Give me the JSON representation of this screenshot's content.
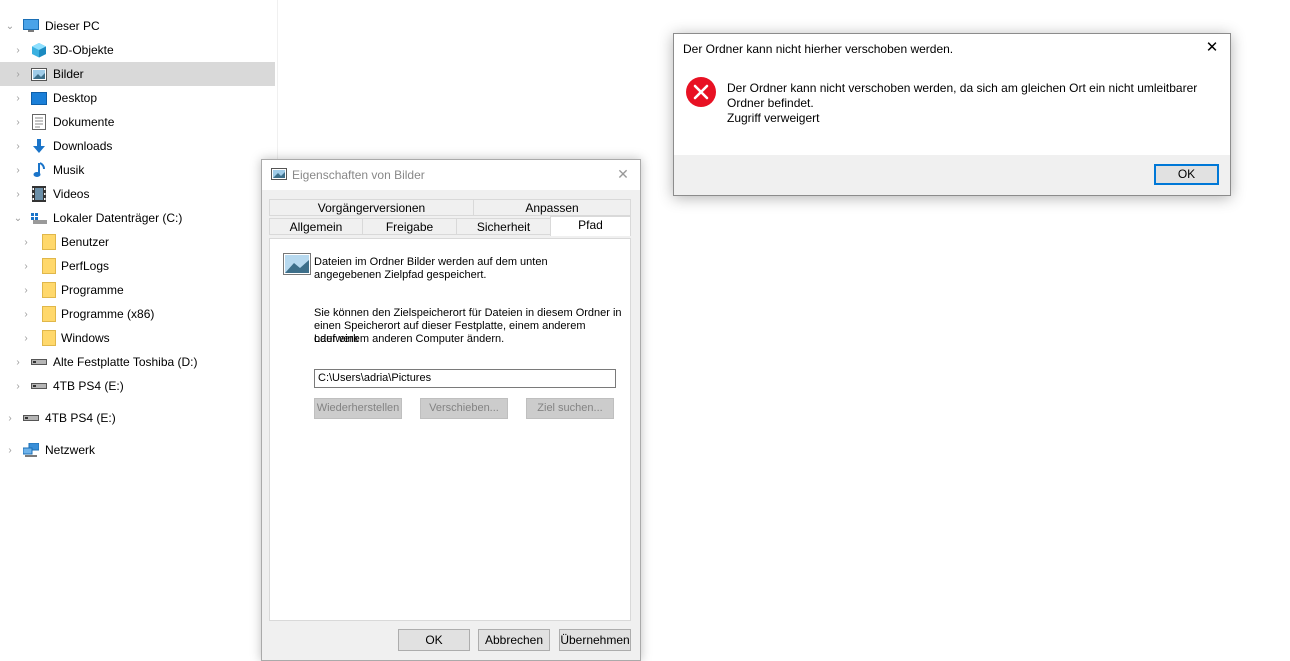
{
  "tree": {
    "items": [
      {
        "label": "Dieser PC",
        "icon": "computer-icon",
        "expanded": true
      },
      {
        "label": "3D-Objekte",
        "icon": "cube-icon"
      },
      {
        "label": "Bilder",
        "icon": "pictures-icon",
        "selected": true
      },
      {
        "label": "Desktop",
        "icon": "desktop-icon"
      },
      {
        "label": "Dokumente",
        "icon": "document-icon"
      },
      {
        "label": "Downloads",
        "icon": "download-icon"
      },
      {
        "label": "Musik",
        "icon": "music-icon"
      },
      {
        "label": "Videos",
        "icon": "video-icon"
      },
      {
        "label": "Lokaler Datenträger (C:)",
        "icon": "drive-icon",
        "expanded": true
      },
      {
        "label": "Benutzer",
        "icon": "folder-icon"
      },
      {
        "label": "PerfLogs",
        "icon": "folder-icon"
      },
      {
        "label": "Programme",
        "icon": "folder-icon"
      },
      {
        "label": "Programme (x86)",
        "icon": "folder-icon"
      },
      {
        "label": "Windows",
        "icon": "folder-icon"
      },
      {
        "label": "Alte Festplatte Toshiba (D:)",
        "icon": "drive-icon"
      },
      {
        "label": "4TB PS4 (E:)",
        "icon": "drive-icon"
      },
      {
        "label": "4TB PS4 (E:)",
        "icon": "drive-icon"
      },
      {
        "label": "Netzwerk",
        "icon": "network-icon"
      }
    ]
  },
  "props": {
    "title": "Eigenschaften von Bilder",
    "tabs_top": [
      "Vorgängerversionen",
      "Anpassen"
    ],
    "tabs_bottom": [
      "Allgemein",
      "Freigabe",
      "Sicherheit",
      "Pfad"
    ],
    "active_tab": "Pfad",
    "info_text_1": "Dateien im Ordner Bilder werden auf dem unten",
    "info_text_2": "angegebenen Zielpfad gespeichert.",
    "desc_1": "Sie können den Zielspeicherort für Dateien in diesem Ordner in",
    "desc_2": "einen Speicherort auf dieser Festplatte, einem anderem Laufwerk",
    "desc_3": "oder einem anderen Computer ändern.",
    "path_value": "C:\\Users\\adria\\Pictures",
    "btn_restore": "Wiederherstellen",
    "btn_move": "Verschieben...",
    "btn_find": "Ziel suchen...",
    "btn_ok": "OK",
    "btn_cancel": "Abbrechen",
    "btn_apply": "Übernehmen"
  },
  "error": {
    "title": "Der Ordner kann nicht hierher verschoben werden.",
    "msg_1": "Der Ordner kann nicht verschoben werden, da sich am gleichen Ort ein nicht umleitbarer",
    "msg_2": "Ordner befindet.",
    "msg_3": "Zugriff verweigert",
    "ok": "OK",
    "icon": "error-icon",
    "icon_color": "#e81123"
  },
  "colors": {
    "selection": "#d9d9d9",
    "accent": "#0078d7",
    "folder": "#ffd86b"
  }
}
